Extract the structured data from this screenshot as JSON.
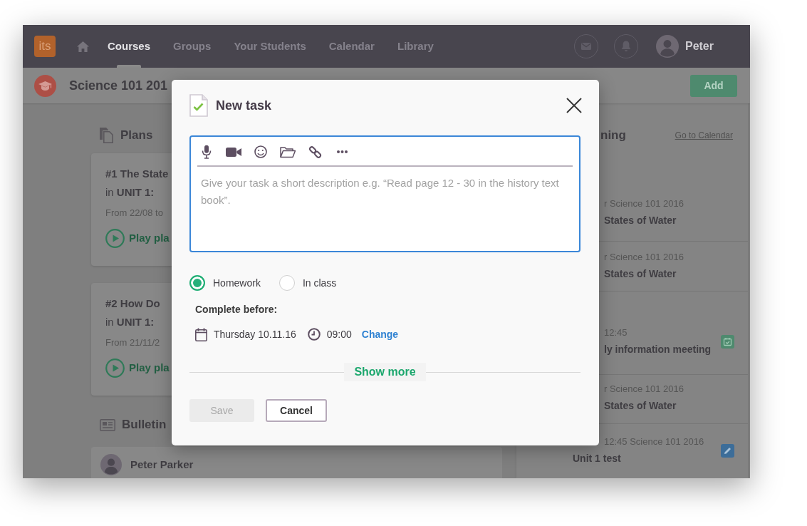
{
  "nav": {
    "logo": "its",
    "items": [
      {
        "label": "Courses",
        "selected": true
      },
      {
        "label": "Groups",
        "selected": false
      },
      {
        "label": "Your Students",
        "selected": false
      },
      {
        "label": "Calendar",
        "selected": false
      },
      {
        "label": "Library",
        "selected": false
      }
    ],
    "user": "Peter"
  },
  "course": {
    "title": "Science 101 201",
    "add_button": "Add"
  },
  "plans": {
    "title": "Plans",
    "cards": [
      {
        "title": "#1 The State",
        "unit": "in **UNIT 1:**",
        "dates": "From 22/08 to",
        "action": "Play pla"
      },
      {
        "title": "#2 How Do",
        "unit": "in **UNIT 1:**",
        "dates": "From 21/11/2",
        "action": "Play pla"
      }
    ]
  },
  "bulletins": {
    "title": "Bulletin",
    "posts": [
      {
        "author": "Peter Parker"
      }
    ]
  },
  "upcoming": {
    "title": "ning",
    "link": "Go to Calendar",
    "rows": [
      {
        "kind": "lesson",
        "meta": "r Science 101 2016",
        "title": "States of Water"
      },
      {
        "kind": "lesson",
        "meta": "r Science 101 2016",
        "title": "States of Water"
      },
      {
        "kind": "meeting",
        "meta": "12:45",
        "title": "ly information meeting"
      },
      {
        "kind": "lesson",
        "meta": "r Science 101 2016",
        "title": "States of Water"
      },
      {
        "kind": "test",
        "meta": "12:45 Science 101 2016",
        "title": "Unit 1 test"
      }
    ]
  },
  "modal": {
    "title": "New task",
    "placeholder": "Give your task a short description e.g. “Read page 12 - 30 in the history text book”.",
    "task_types": [
      {
        "label": "Homework",
        "selected": true
      },
      {
        "label": "In class",
        "selected": false
      }
    ],
    "deadline": {
      "label": "Complete before:",
      "date": "Thursday 10.11.16",
      "time": "09:00",
      "change": "Change"
    },
    "show_more": "Show more",
    "buttons": [
      {
        "label": "Save",
        "kind": "primary",
        "disabled": true
      },
      {
        "label": "Cancel",
        "kind": "secondary",
        "disabled": false
      }
    ]
  }
}
